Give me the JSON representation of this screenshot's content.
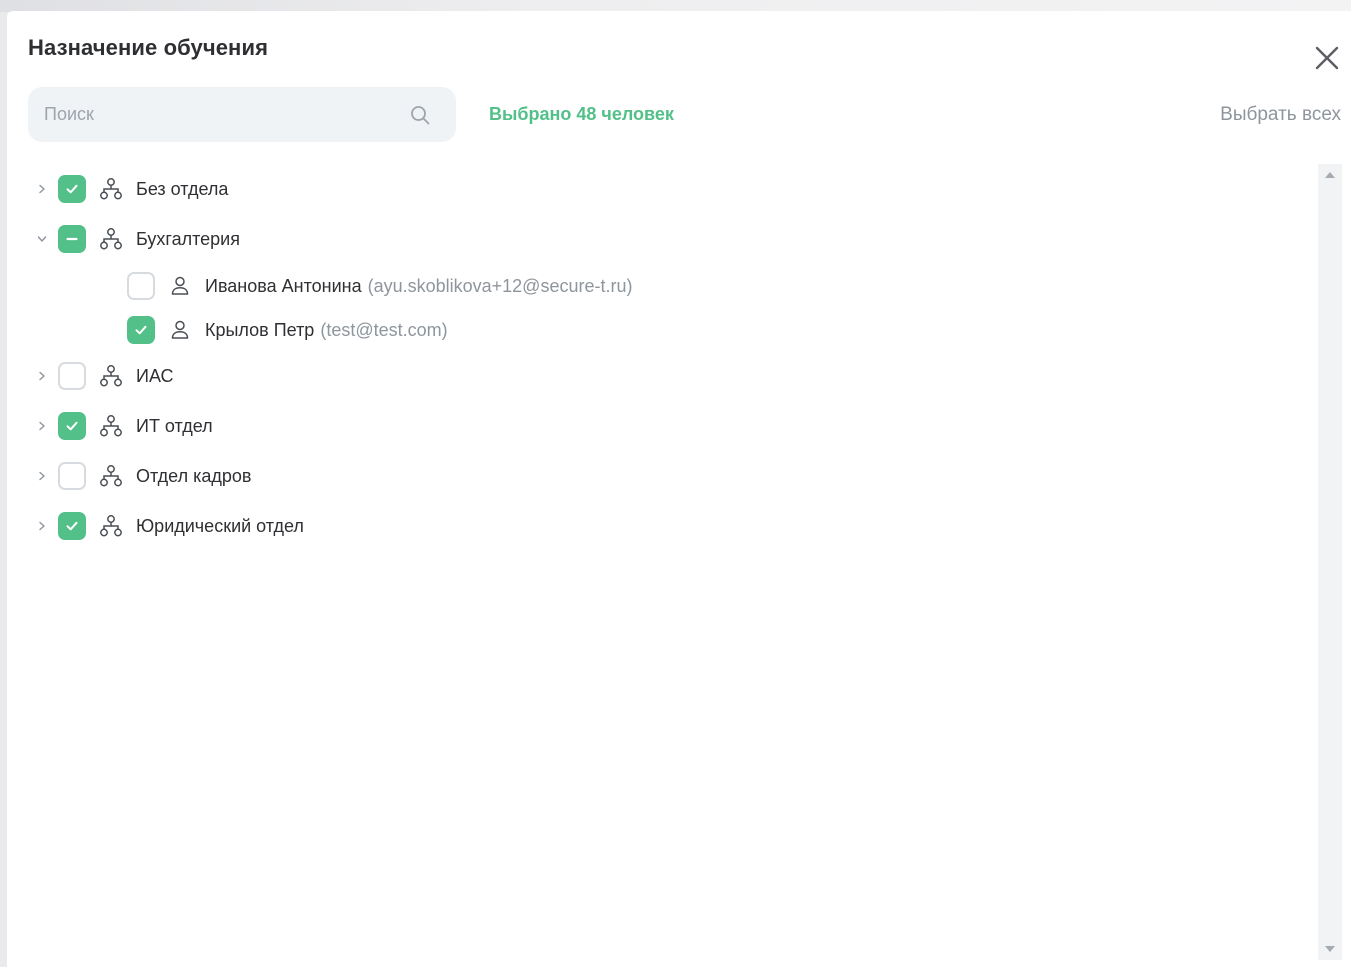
{
  "dialog": {
    "title": "Назначение обучения",
    "close_icon": "close-icon"
  },
  "search": {
    "placeholder": "Поиск",
    "value": "",
    "icon": "search-icon"
  },
  "selection": {
    "count_text": "Выбрано 48 человек",
    "select_all_label": "Выбрать всех"
  },
  "colors": {
    "accent": "#52c088",
    "muted_text": "#8e959d",
    "checkbox_border": "#d7dbe0"
  },
  "tree": [
    {
      "type": "department",
      "label": "Без отдела",
      "expanded": false,
      "state": "checked"
    },
    {
      "type": "department",
      "label": "Бухгалтерия",
      "expanded": true,
      "state": "partial",
      "children": [
        {
          "type": "user",
          "name": "Иванова Антонина",
          "email": "(ayu.skoblikova+12@secure-t.ru)",
          "state": "unchecked"
        },
        {
          "type": "user",
          "name": "Крылов Петр",
          "email": "(test@test.com)",
          "state": "checked"
        }
      ]
    },
    {
      "type": "department",
      "label": "ИАС",
      "expanded": false,
      "state": "unchecked"
    },
    {
      "type": "department",
      "label": "ИТ отдел",
      "expanded": false,
      "state": "checked"
    },
    {
      "type": "department",
      "label": "Отдел кадров",
      "expanded": false,
      "state": "unchecked"
    },
    {
      "type": "department",
      "label": "Юридический отдел",
      "expanded": false,
      "state": "checked"
    }
  ]
}
